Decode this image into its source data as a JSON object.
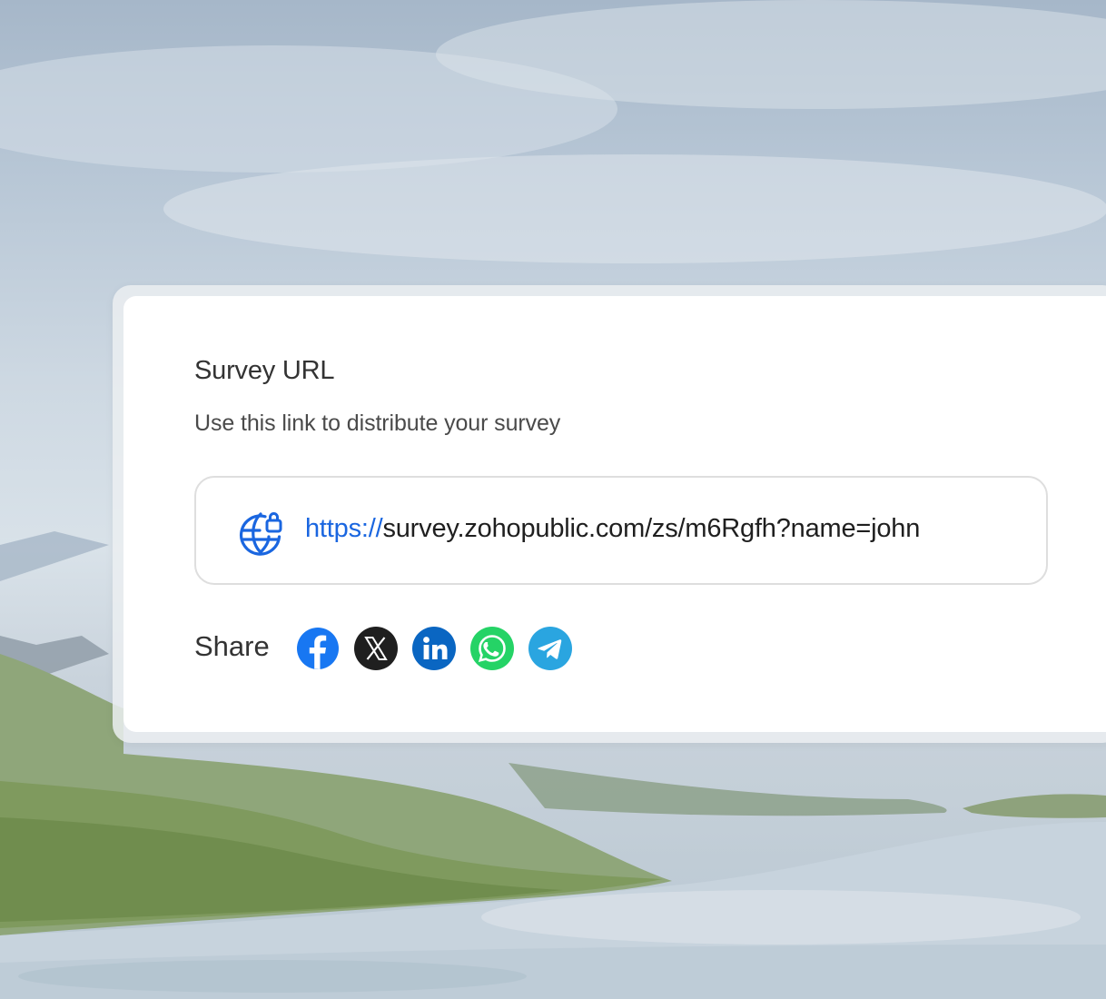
{
  "card": {
    "title": "Survey URL",
    "subtitle": "Use this link to distribute your survey",
    "url_protocol": "https://",
    "url_rest": "survey.zohopublic.com/zs/m6Rgfh?name=john",
    "share_label": "Share"
  },
  "icons": {
    "url": "globe-icon",
    "share": [
      "facebook-icon",
      "x-icon",
      "linkedin-icon",
      "whatsapp-icon",
      "telegram-icon"
    ]
  },
  "colors": {
    "accent": "#1a66e0",
    "facebook": "#1877f2",
    "x": "#1f1f1f",
    "linkedin": "#0a66c2",
    "whatsapp": "#25d366",
    "telegram": "#2aa5e0"
  }
}
